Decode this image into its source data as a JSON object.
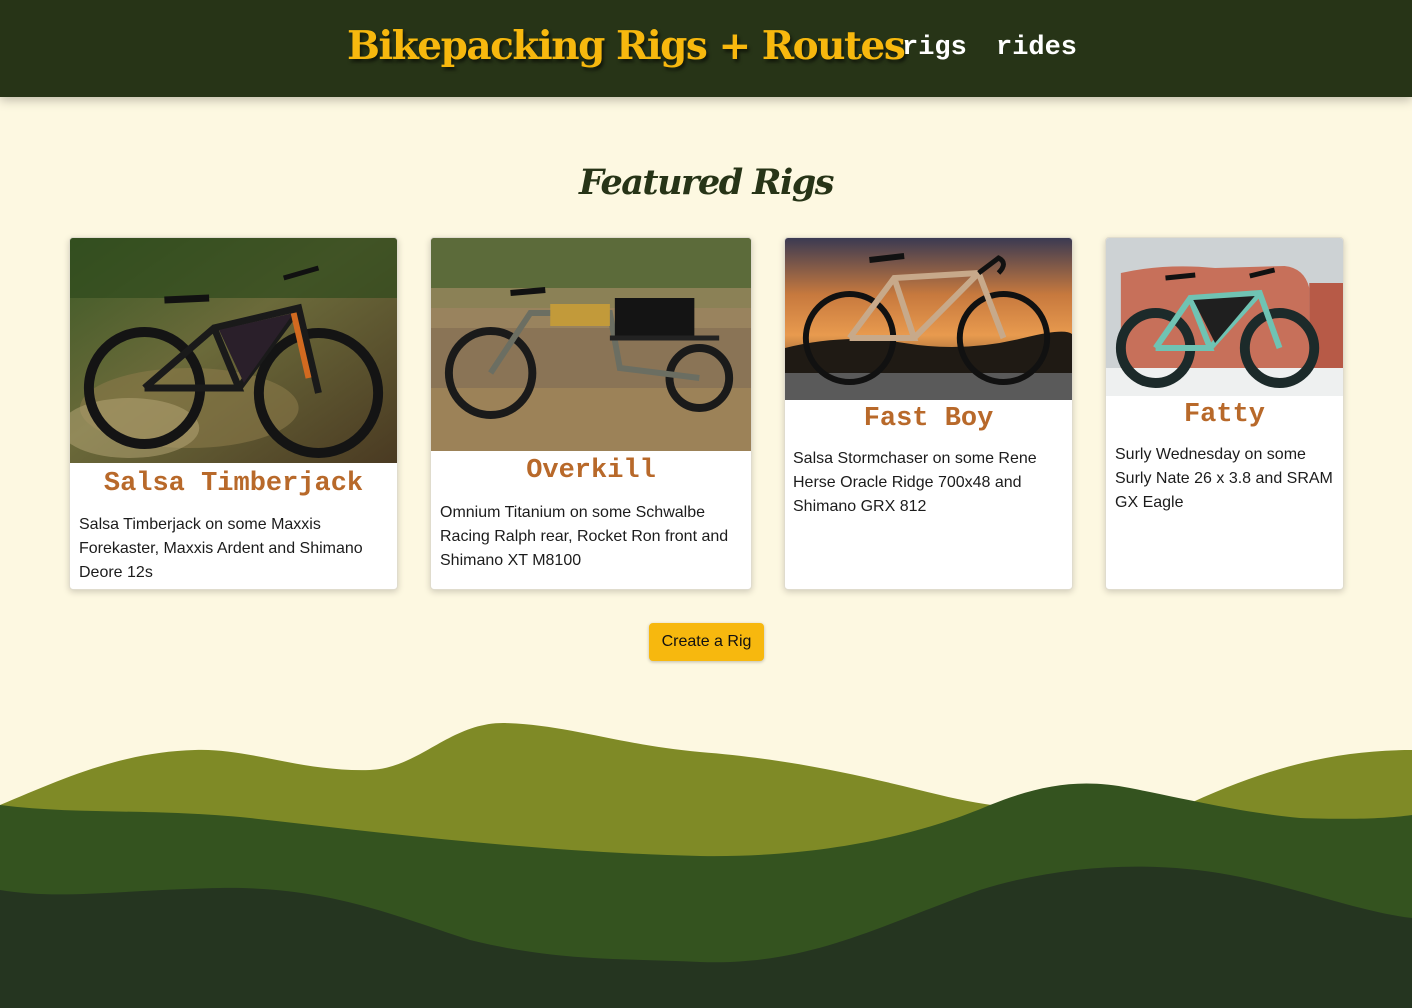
{
  "header": {
    "brand": "Bikepacking Rigs + Routes",
    "nav": [
      {
        "label": "rigs"
      },
      {
        "label": "rides"
      }
    ]
  },
  "main": {
    "title": "Featured Rigs",
    "cards": [
      {
        "name": "Salsa Timberjack",
        "description": "Salsa Timberjack on some Maxxis Forekaster, Maxxis Ardent and Shimano Deore 12s"
      },
      {
        "name": "Overkill",
        "description": "Omnium Titanium on some Schwalbe Racing Ralph rear, Rocket Ron front and Shimano XT M8100"
      },
      {
        "name": "Fast Boy",
        "description": "Salsa Stormchaser on some Rene Herse Oracle Ridge 700x48 and Shimano GRX 812"
      },
      {
        "name": "Fatty",
        "description": "Surly Wednesday on some Surly Nate 26 x 3.8 and SRAM GX Eagle"
      }
    ],
    "create_label": "Create a Rig"
  },
  "colors": {
    "header_bg": "#273417",
    "brand": "#f7b80e",
    "page_bg": "#fdf8e1",
    "rig_name": "#b8692a",
    "button": "#f7b80e",
    "hill_light": "#7f8a26",
    "hill_mid": "#34531f",
    "hill_dark": "#253520"
  }
}
